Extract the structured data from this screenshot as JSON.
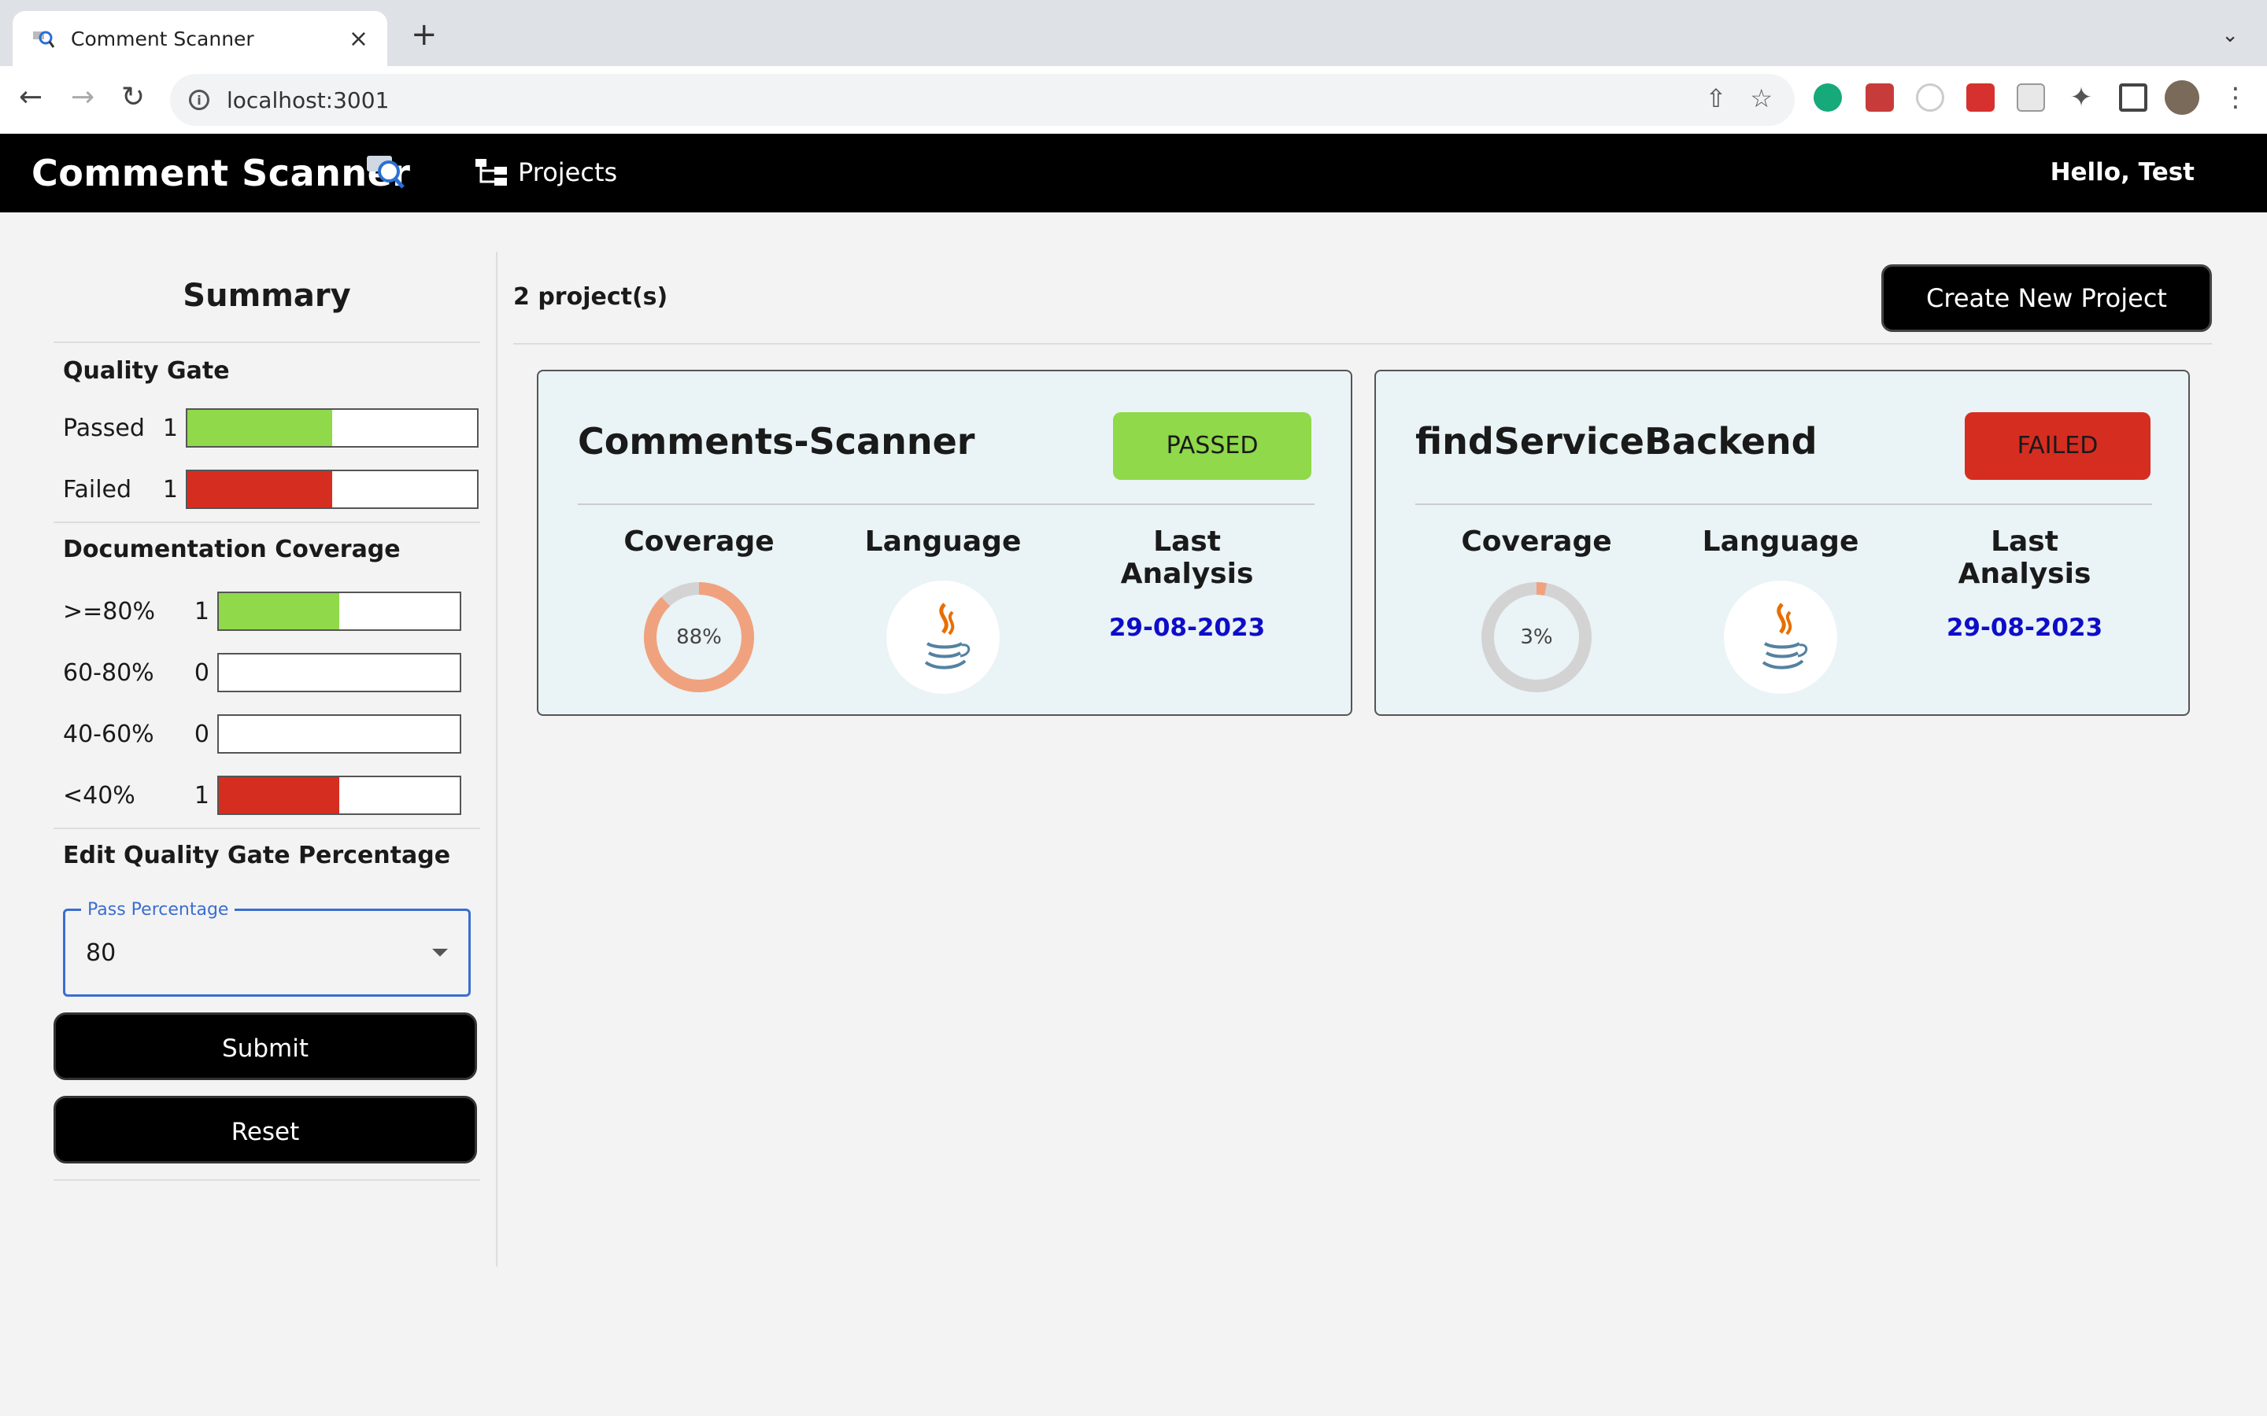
{
  "browser": {
    "tab_title": "Comment Scanner",
    "url": "localhost:3001"
  },
  "app": {
    "title": "Comment Scanner",
    "nav_projects": "Projects",
    "greeting": "Hello, Test"
  },
  "sidebar": {
    "title": "Summary",
    "quality_gate": {
      "title": "Quality Gate",
      "rows": [
        {
          "label": "Passed",
          "count": "1",
          "fraction": 0.5,
          "color": "#8fd94a"
        },
        {
          "label": "Failed",
          "count": "1",
          "fraction": 0.5,
          "color": "#d62d21"
        }
      ]
    },
    "doc_coverage": {
      "title": "Documentation Coverage",
      "rows": [
        {
          "label": ">=80%",
          "count": "1",
          "fraction": 0.5,
          "color": "#8fd94a"
        },
        {
          "label": "60-80%",
          "count": "0",
          "fraction": 0,
          "color": "#8fd94a"
        },
        {
          "label": "40-60%",
          "count": "0",
          "fraction": 0,
          "color": "#8fd94a"
        },
        {
          "label": "<40%",
          "count": "1",
          "fraction": 0.5,
          "color": "#d62d21"
        }
      ]
    },
    "edit_gate": {
      "title": "Edit Quality Gate Percentage",
      "select_label": "Pass Percentage",
      "select_value": "80",
      "submit_label": "Submit",
      "reset_label": "Reset"
    }
  },
  "main": {
    "project_count": "2 project(s)",
    "create_label": "Create New Project",
    "columns": {
      "coverage": "Coverage",
      "language": "Language",
      "last_analysis": "Last Analysis"
    },
    "projects": [
      {
        "name": "Comments-Scanner",
        "status": "PASSED",
        "status_color": "#8fd94a",
        "coverage": "88%",
        "coverage_value": 0.88,
        "language_icon": "java-icon",
        "last_analysis": "29-08-2023"
      },
      {
        "name": "findServiceBackend",
        "status": "FAILED",
        "status_color": "#d62d21",
        "coverage": "3%",
        "coverage_value": 0.03,
        "language_icon": "java-icon",
        "last_analysis": "29-08-2023"
      }
    ]
  }
}
